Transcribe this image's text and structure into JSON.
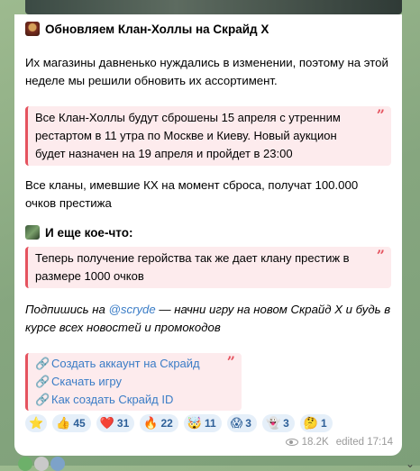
{
  "post": {
    "title": "Обновляем Клан-Холлы на Скрайд Х",
    "intro": "Их магазины давненько нуждались в изменении, поэтому на этой неделе мы решили обновить их ассортимент.",
    "quote1": "Все Клан-Холлы будут сброшены 15 апреля с утренним рестартом в 11 утра по Москве и Киеву. Новый аукцион будет назначен на 19 апреля и пройдет в 23:00",
    "prestige": "Все кланы, имевшие КХ на момент сброса, получат 100.000 очков престижа",
    "subheading": "И еще кое-что:",
    "quote2": "Теперь получение геройства так же дает клану престиж в размере 1000 очков",
    "subscribe_before": "Подпишись на ",
    "subscribe_mention": "@scryde",
    "subscribe_after": " — начни игру на новом Скрайд Х и будь в курсе всех новостей и промокодов",
    "quote_mark": "”"
  },
  "links": [
    {
      "label": "Создать аккаунт на Скрайд",
      "icon": "link-red-icon"
    },
    {
      "label": "Скачать игру",
      "icon": "link-blue-icon"
    },
    {
      "label": "Как создать Скрайд ID",
      "icon": "link-green-icon"
    }
  ],
  "reactions": [
    {
      "emoji": "⭐",
      "count": "",
      "icon": "star-icon"
    },
    {
      "emoji": "👍",
      "count": "45",
      "icon": "thumbs-up-icon"
    },
    {
      "emoji": "❤️",
      "count": "31",
      "icon": "heart-icon"
    },
    {
      "emoji": "🔥",
      "count": "22",
      "icon": "fire-icon"
    },
    {
      "emoji": "🤯",
      "count": "11",
      "icon": "mind-blown-icon"
    },
    {
      "emoji": "😱",
      "count": "3",
      "icon": "scream-icon"
    },
    {
      "emoji": "👻",
      "count": "3",
      "icon": "ghost-icon"
    },
    {
      "emoji": "🤔",
      "count": "1",
      "icon": "thinking-icon"
    }
  ],
  "footer": {
    "views": "18.2K",
    "edited": "edited 17:14"
  },
  "colors": {
    "accent_link": "#3a7cc6",
    "quote_border": "#e5535f",
    "quote_bg": "#fdebed",
    "reaction_bg": "#e5eff9"
  }
}
